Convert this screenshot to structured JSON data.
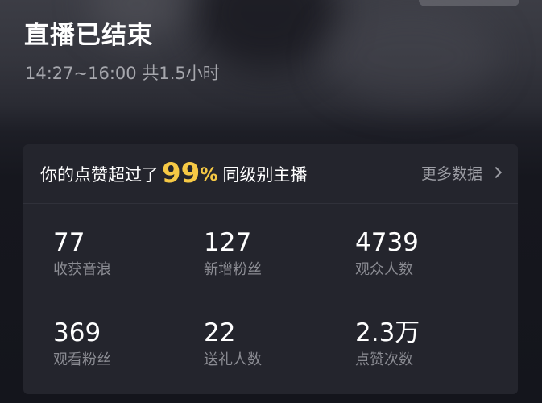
{
  "header": {
    "title": "直播已结束",
    "time_range": "14:27~16:00",
    "duration": "共1.5小时"
  },
  "card": {
    "likes_prefix": "你的点赞超过了",
    "likes_percent": "99",
    "percent_sign": "%",
    "likes_suffix": "同级别主播",
    "more_link": "更多数据",
    "stats": [
      {
        "value": "77",
        "label": "收获音浪"
      },
      {
        "value": "127",
        "label": "新增粉丝"
      },
      {
        "value": "4739",
        "label": "观众人数"
      },
      {
        "value": "369",
        "label": "观看粉丝"
      },
      {
        "value": "22",
        "label": "送礼人数"
      },
      {
        "value": "2.3万",
        "label": "点赞次数"
      }
    ]
  },
  "colors": {
    "accent": "#f6c945",
    "card_bg": "#24252d",
    "label_gray": "#8b8c93"
  },
  "icons": {
    "more_link_icon": "chevron-right-icon"
  }
}
